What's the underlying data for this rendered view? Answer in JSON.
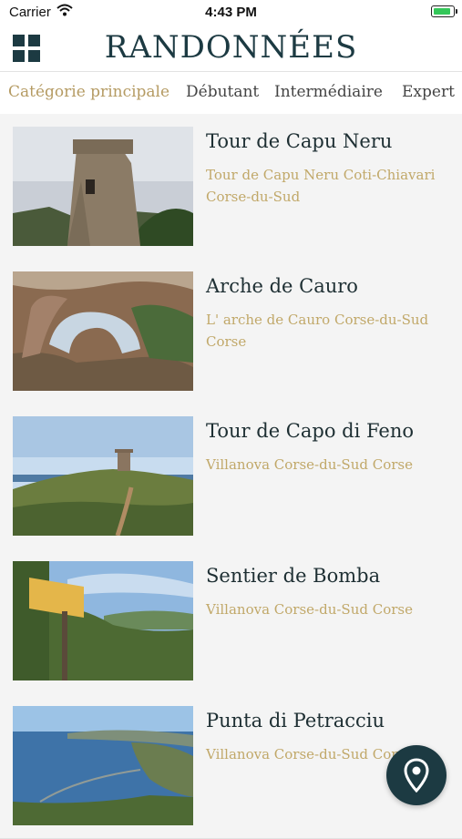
{
  "status_bar": {
    "carrier": "Carrier",
    "time": "4:43 PM"
  },
  "header": {
    "title": "RANDONNÉES",
    "menu_icon": "grid-menu-icon"
  },
  "tabs": [
    {
      "label": "Catégorie principale",
      "active": true
    },
    {
      "label": "Débutant",
      "active": false
    },
    {
      "label": "Intermédiaire",
      "active": false
    },
    {
      "label": "Expert",
      "active": false
    }
  ],
  "hikes": [
    {
      "title": "Tour de Capu Neru",
      "subtitle": "Tour de Capu Neru Coti-Chiavari Corse-du-Sud",
      "image": "stone-tower-photo"
    },
    {
      "title": "Arche de Cauro",
      "subtitle": "L' arche de Cauro Corse-du-Sud Corse",
      "image": "rock-arch-photo"
    },
    {
      "title": "Tour de Capo di Feno",
      "subtitle": "Villanova Corse-du-Sud Corse",
      "image": "coastal-tower-photo"
    },
    {
      "title": "Sentier de Bomba",
      "subtitle": "Villanova Corse-du-Sud Corse",
      "image": "trail-sign-photo"
    },
    {
      "title": "Punta di Petracciu",
      "subtitle": "Villanova Corse-du-Sud Corse",
      "image": "bay-view-photo"
    }
  ],
  "map_button": {
    "icon": "map-pin-icon"
  },
  "colors": {
    "primary": "#1c3a42",
    "accent": "#b59b63",
    "subtitle": "#c1a869"
  }
}
